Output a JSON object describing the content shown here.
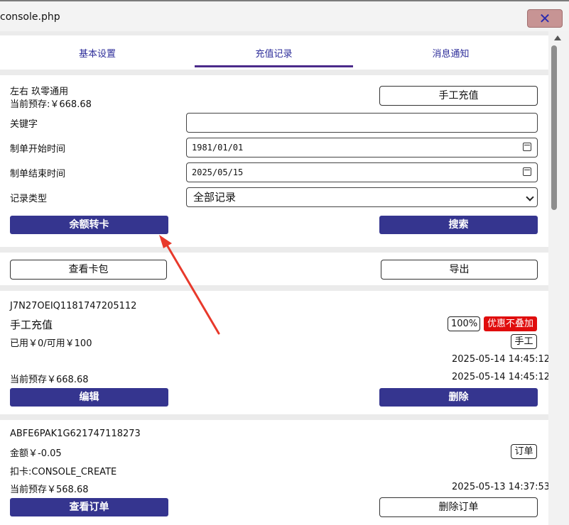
{
  "window": {
    "title": "console.php",
    "close_label": "✕"
  },
  "tabs": [
    {
      "label": "基本设置",
      "active": false
    },
    {
      "label": "充值记录",
      "active": true
    },
    {
      "label": "消息通知",
      "active": false
    }
  ],
  "account": {
    "name": "左右 玖零通用",
    "balance": "当前预存:￥668.68",
    "manual_recharge_label": "手工充值"
  },
  "filters": {
    "keyword_label": "关键字",
    "keyword_value": "",
    "start_label": "制单开始时间",
    "start_value": "1981/01/01",
    "end_label": "制单结束时间",
    "end_value": "2025/05/15",
    "type_label": "记录类型",
    "type_value": "全部记录",
    "transfer_label": "余额转卡",
    "search_label": "搜索"
  },
  "actions": {
    "card_wallet_label": "查看卡包",
    "export_label": "导出"
  },
  "records": [
    {
      "id": "J7N27OEIQ1181747205112",
      "title": "手工充值",
      "percent_badge": "100%",
      "no_stack_badge": "优惠不叠加",
      "type_badge": "手工",
      "usage": "已用￥0/可用￥100",
      "time1": "2025-05-14 14:45:12",
      "balance": "当前预存￥668.68",
      "time2": "2025-05-14 14:45:12",
      "edit_label": "编辑",
      "delete_label": "删除"
    },
    {
      "id": "ABFE6PAK1G621747118273",
      "amount": "金额￥-0.05",
      "type_badge": "订单",
      "deduct": "扣卡:CONSOLE_CREATE",
      "balance": "当前预存￥568.68",
      "time": "2025-05-13 14:37:53",
      "view_order_label": "查看订单",
      "delete_order_label": "删除订单"
    }
  ],
  "colors": {
    "primary": "#35358f",
    "tab_underline": "#4b2a8a",
    "danger": "#e00d0d",
    "annotation_arrow": "#e8392b"
  }
}
